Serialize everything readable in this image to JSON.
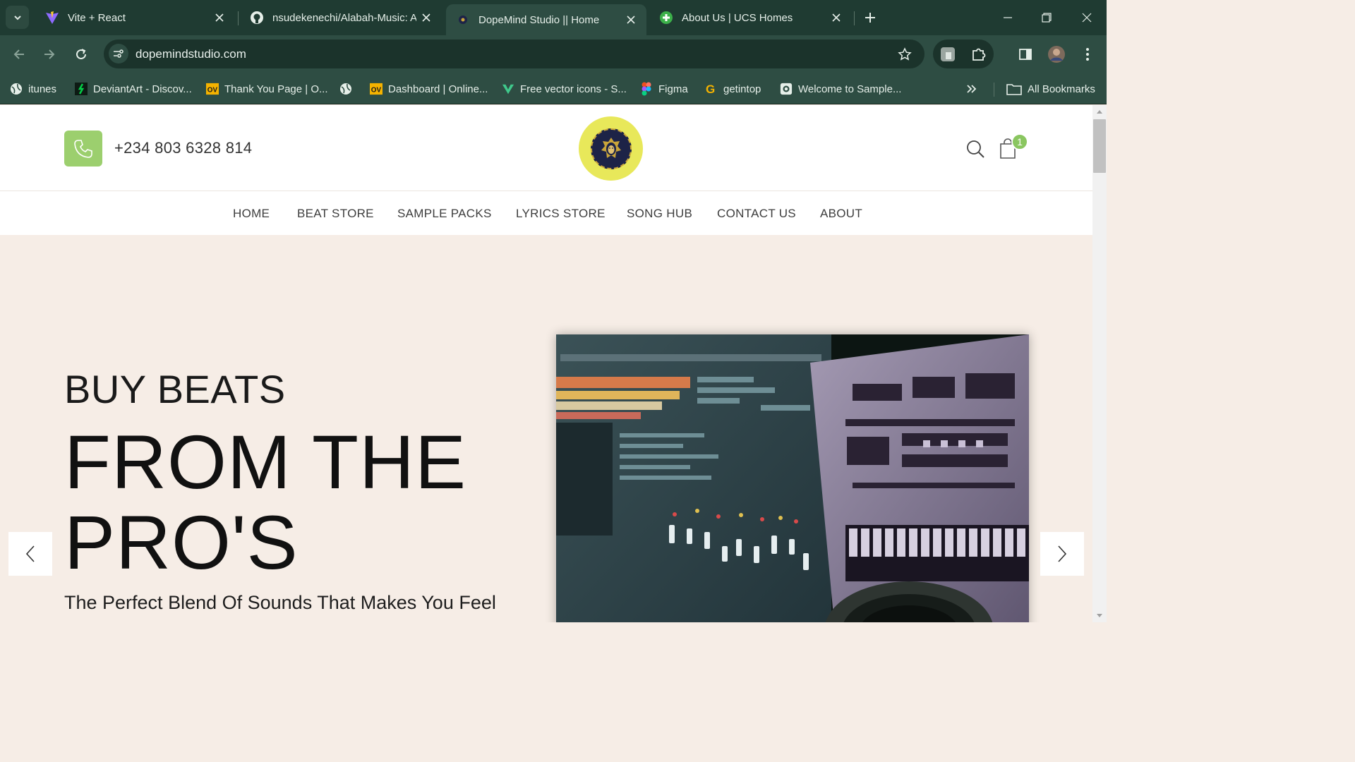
{
  "browser": {
    "tabs": [
      {
        "title": "Vite + React",
        "icon": "vite-icon"
      },
      {
        "title": "nsudekenechi/Alabah-Music: A",
        "icon": "github-icon"
      },
      {
        "title": "DopeMind Studio || Home",
        "icon": "dopemind-favicon",
        "active": true
      },
      {
        "title": "About Us | UCS Homes",
        "icon": "green-plus-icon"
      }
    ],
    "url": "dopemindstudio.com",
    "bookmarks": [
      {
        "label": "itunes",
        "icon": "globe-icon"
      },
      {
        "label": "DeviantArt - Discov...",
        "icon": "deviantart-icon"
      },
      {
        "label": "Thank You Page | O...",
        "icon": "ov-icon"
      },
      {
        "label": "",
        "icon": "globe-icon"
      },
      {
        "label": "Dashboard | Online...",
        "icon": "ov-icon"
      },
      {
        "label": "Free vector icons - S...",
        "icon": "svgrepo-icon"
      },
      {
        "label": "Figma",
        "icon": "figma-icon"
      },
      {
        "label": "getintop",
        "icon": "getintop-icon"
      },
      {
        "label": "Welcome to Sample...",
        "icon": "camera-icon"
      }
    ],
    "all_bookmarks_label": "All Bookmarks"
  },
  "header": {
    "phone": "+234 803 6328 814",
    "cart_count": "1"
  },
  "nav": {
    "items": [
      "HOME",
      "BEAT STORE",
      "SAMPLE PACKS",
      "LYRICS STORE",
      "SONG HUB",
      "CONTACT US",
      "ABOUT"
    ]
  },
  "hero": {
    "subtitle": "BUY BEATS",
    "title_line1": "FROM THE",
    "title_line2": "PRO'S",
    "tagline": "The Perfect Blend Of Sounds That Makes You Feel"
  },
  "colors": {
    "chrome_dark": "#1f3b32",
    "chrome_mid": "#2e4d43",
    "accent_green": "#9ccf6e",
    "logo_yellow": "#e8e85a",
    "hero_bg": "#f6ede6"
  }
}
